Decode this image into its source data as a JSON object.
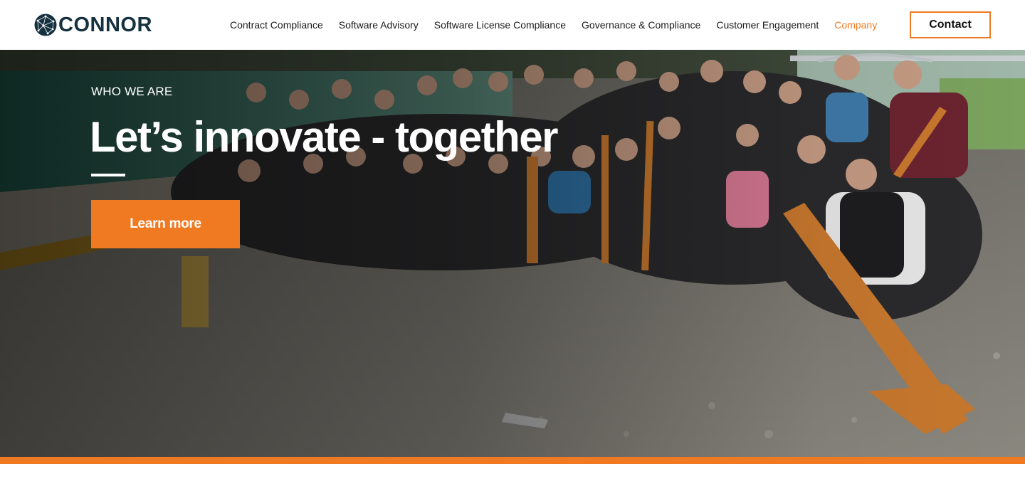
{
  "brand": {
    "name": "CONNOR",
    "logo_color": "#15303f"
  },
  "nav": {
    "items": [
      {
        "label": "Contract Compliance",
        "active": false
      },
      {
        "label": "Software Advisory",
        "active": false
      },
      {
        "label": "Software License Compliance",
        "active": false
      },
      {
        "label": "Governance & Compliance",
        "active": false
      },
      {
        "label": "Customer Engagement",
        "active": false
      },
      {
        "label": "Company",
        "active": true
      }
    ],
    "contact_label": "Contact"
  },
  "hero": {
    "eyebrow": "WHO WE ARE",
    "title": "Let’s innovate - together",
    "cta_label": "Learn more",
    "photo_icon": "team-photo-image"
  },
  "colors": {
    "accent": "#f07a22",
    "nav_text": "#1a1a1a",
    "white": "#ffffff"
  }
}
